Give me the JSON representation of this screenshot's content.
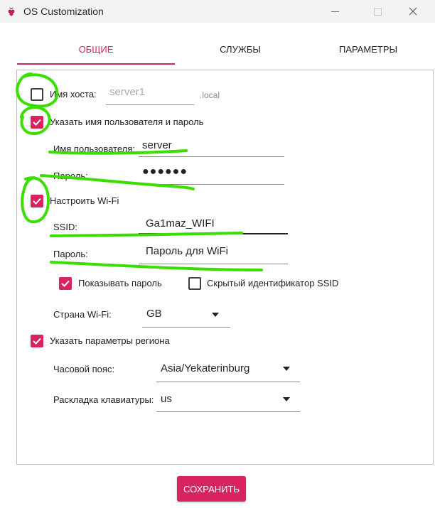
{
  "window": {
    "title": "OS Customization"
  },
  "tabs": [
    {
      "label": "ОБЩИЕ",
      "active": true
    },
    {
      "label": "СЛУЖБЫ",
      "active": false
    },
    {
      "label": "ПАРАМЕТРЫ",
      "active": false
    }
  ],
  "general": {
    "hostname": {
      "label": "Имя хоста:",
      "placeholder": "server1",
      "suffix": ".local",
      "checked": false
    },
    "user": {
      "label": "Указать имя пользователя и пароль",
      "checked": true,
      "username_label": "Имя пользователя:",
      "username_value": "server",
      "password_label": "Пароль:",
      "password_value": "●●●●●●"
    },
    "wifi": {
      "label": "Настроить Wi-Fi",
      "checked": true,
      "ssid_label": "SSID:",
      "ssid_value": "Ga1maz_WIFI",
      "password_label": "Пароль:",
      "password_value": "Пароль для WiFi",
      "show_password_label": "Показывать пароль",
      "show_password_checked": true,
      "hidden_ssid_label": "Скрытый идентификатор SSID",
      "hidden_ssid_checked": false,
      "country_label": "Страна Wi-Fi:",
      "country_value": "GB"
    },
    "locale": {
      "label": "Указать параметры региона",
      "checked": true,
      "timezone_label": "Часовой пояс:",
      "timezone_value": "Asia/Yekaterinburg",
      "keyboard_label": "Раскладка клавиатуры:",
      "keyboard_value": "us"
    }
  },
  "footer": {
    "save_label": "СОХРАНИТЬ"
  },
  "colors": {
    "accent": "#d9235e",
    "annotation": "#3adf00"
  }
}
